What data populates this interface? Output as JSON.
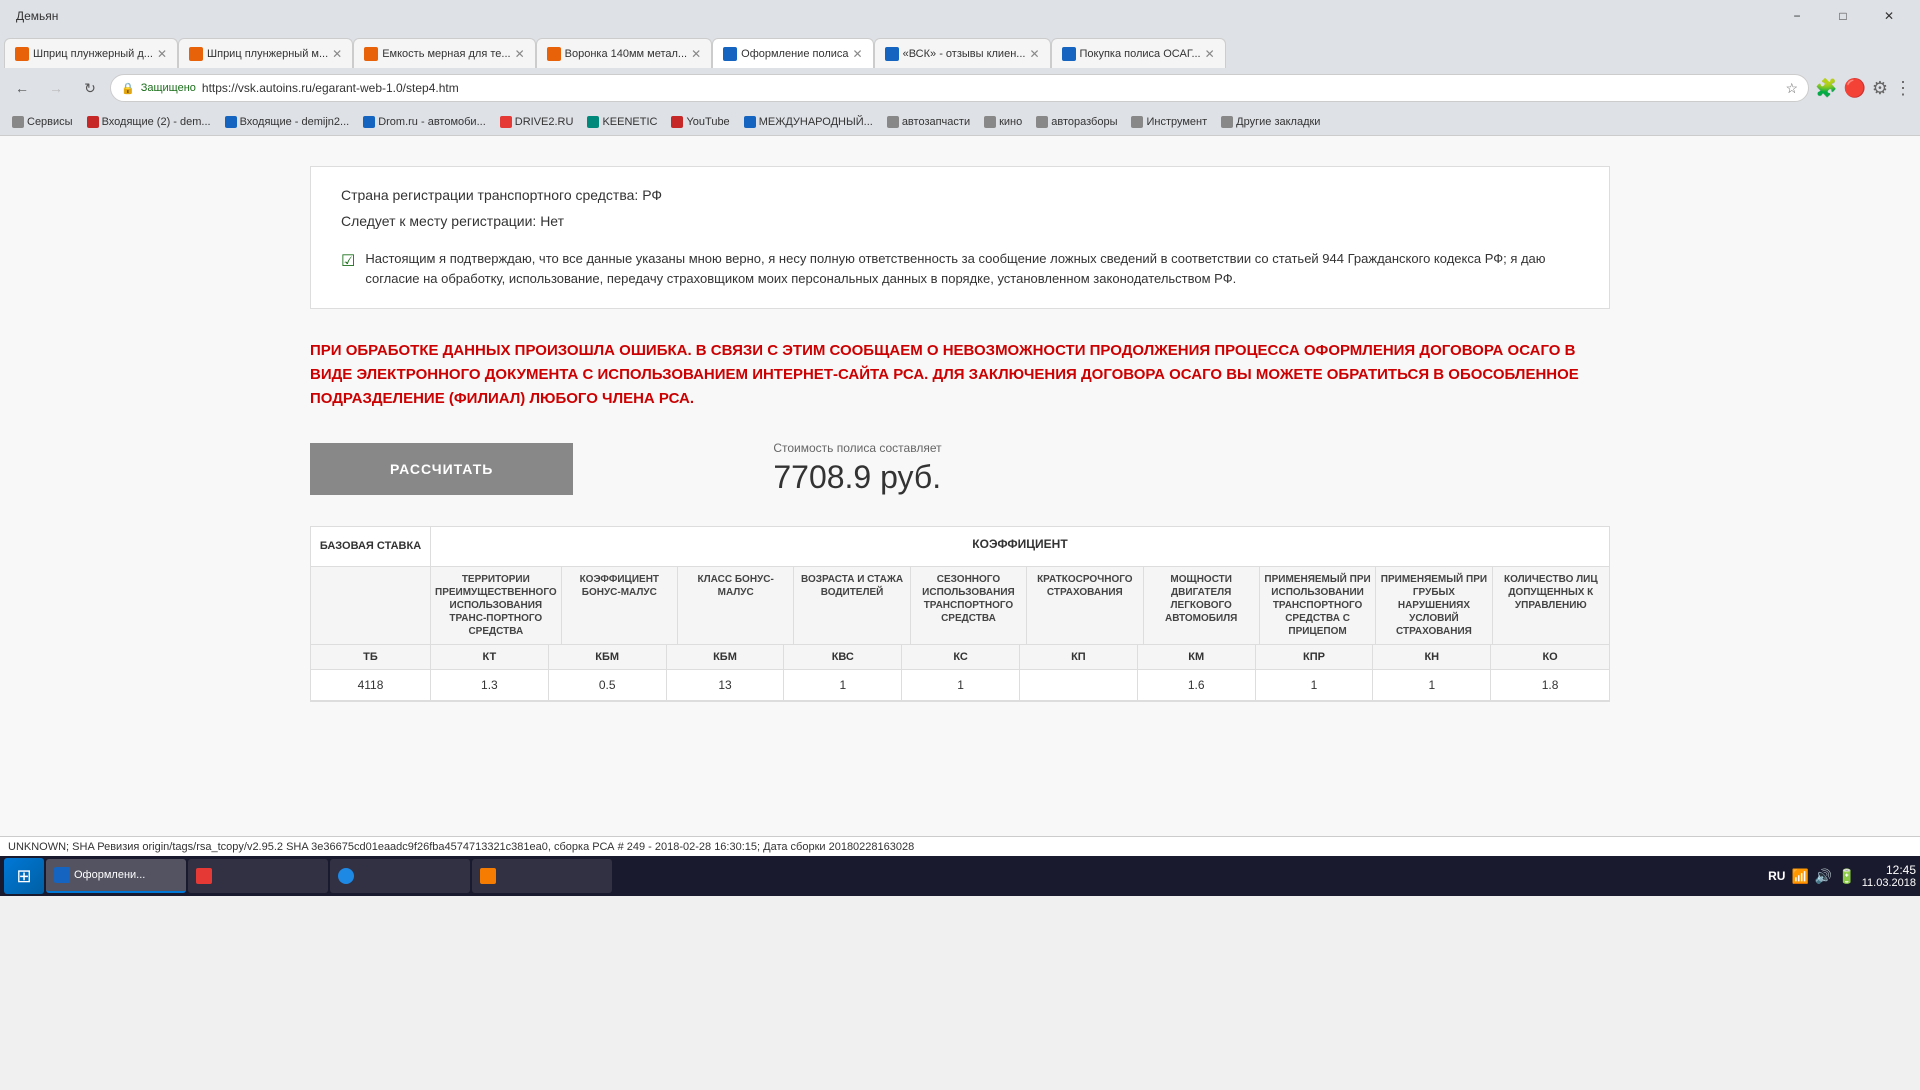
{
  "browser": {
    "title_user": "Демьян",
    "address": {
      "secure_label": "Защищено",
      "url": "https://vsk.autoins.ru/egarant-web-1.0/step4.htm"
    },
    "tabs": [
      {
        "id": "tab1",
        "title": "Шприц плунжерный д...",
        "active": false,
        "favicon_color": "#e8620a"
      },
      {
        "id": "tab2",
        "title": "Шприц плунжерный м...",
        "active": false,
        "favicon_color": "#e8620a"
      },
      {
        "id": "tab3",
        "title": "Емкость мерная для те...",
        "active": false,
        "favicon_color": "#e8620a"
      },
      {
        "id": "tab4",
        "title": "Воронка 140мм метал...",
        "active": false,
        "favicon_color": "#e8620a"
      },
      {
        "id": "tab5",
        "title": "Оформление полиса",
        "active": true,
        "favicon_color": "#1565c0"
      },
      {
        "id": "tab6",
        "title": "«ВСК» - отзывы клиен...",
        "active": false,
        "favicon_color": "#1565c0"
      },
      {
        "id": "tab7",
        "title": "Покупка полиса ОСАГ...",
        "active": false,
        "favicon_color": "#1565c0"
      }
    ],
    "bookmarks": [
      {
        "label": "Сервисы",
        "favicon_color": "#888"
      },
      {
        "label": "Входящие (2) - dem...",
        "favicon_color": "#c62828"
      },
      {
        "label": "Входящие - demijn2...",
        "favicon_color": "#1565c0"
      },
      {
        "label": "Drom.ru - автомоби...",
        "favicon_color": "#1565c0"
      },
      {
        "label": "DRIVE2.RU",
        "favicon_color": "#e53935"
      },
      {
        "label": "KEENETIC",
        "favicon_color": "#00897b"
      },
      {
        "label": "YouTube",
        "favicon_color": "#c62828"
      },
      {
        "label": "МЕЖДУНАРОДНЫЙ...",
        "favicon_color": "#1565c0"
      },
      {
        "label": "автозапчасти",
        "favicon_color": "#888"
      },
      {
        "label": "кино",
        "favicon_color": "#888"
      },
      {
        "label": "авторазборы",
        "favicon_color": "#888"
      },
      {
        "label": "Инструмент",
        "favicon_color": "#888"
      },
      {
        "label": "Другие закладки",
        "favicon_color": "#888"
      }
    ]
  },
  "page": {
    "info_rows": [
      {
        "label": "Страна регистрации транспортного средства: РФ"
      },
      {
        "label": "Следует к месту регистрации: Нет"
      }
    ],
    "checkbox_text": "Настоящим я подтверждаю, что все данные указаны мною верно, я несу полную ответственность за сообщение ложных сведений в соответствии со статьей 944 Гражданского кодекса РФ; я даю согласие на обработку, использование, передачу страховщиком моих персональных данных в порядке, установленном законодательством РФ.",
    "error_text": "ПРИ ОБРАБОТКЕ ДАННЫХ ПРОИЗОШЛА ОШИБКА. В СВЯЗИ С ЭТИМ СООБЩАЕМ О НЕВОЗМОЖНОСТИ ПРОДОЛЖЕНИЯ ПРОЦЕССА ОФОРМЛЕНИЯ ДОГОВОРА ОСАГО В ВИДЕ ЭЛЕКТРОННОГО ДОКУМЕНТА С ИСПОЛЬЗОВАНИЕМ ИНТЕРНЕТ-САЙТА РСА. ДЛЯ ЗАКЛЮЧЕНИЯ ДОГОВОРА ОСАГО ВЫ МОЖЕТЕ ОБРАТИТЬСЯ В ОБОСОБЛЕННОЕ ПОДРАЗДЕЛЕНИЕ (ФИЛИАЛ) ЛЮБОГО ЧЛЕНА РСА.",
    "calc_button_label": "РАССЧИТАТЬ",
    "price_label": "Стоимость полиса составляет",
    "price_value": "7708.9 руб.",
    "table": {
      "base_stavka_label": "БАЗОВАЯ СТАВКА",
      "coefficient_label": "КОЭФФИЦИЕНТ",
      "columns": [
        {
          "full": "ТЕРРИТОРИИ ПРЕИМУЩЕСТВЕННОГО ИСПОЛЬЗОВАНИЯ ТРАНСПОРТНОГО СРЕДСТВА",
          "abbrev": "КТ"
        },
        {
          "full": "КОЭФФИЦИЕНТ БОНУС-МАЛУС",
          "abbrev": "КБМ"
        },
        {
          "full": "КЛАСС БОНУС-МАЛУС",
          "abbrev": "КБМ"
        },
        {
          "full": "ВОЗРАСТА И СТАЖА ВОДИТЕЛЕЙ",
          "abbrev": "КВС"
        },
        {
          "full": "СЕЗОННОГО ИСПОЛЬЗОВАНИЯ ТРАНСПОРТНОГО СРЕДСТВА",
          "abbrev": "КС"
        },
        {
          "full": "КРАТКОСРОЧНОГО СТРАХОВАНИЯ",
          "abbrev": "КП"
        },
        {
          "full": "МОЩНОСТИ ДВИГАТЕЛЯ ЛЕГКОВОГО АВТОМОБИЛЯ",
          "abbrev": "КМ"
        },
        {
          "full": "ПРИМЕНЯЕМЫЙ ПРИ ИСПОЛЬЗОВАНИИ ТРАНСПОРТНОГО СРЕДСТВА С ПРИЦЕПОМ",
          "abbrev": "КПР"
        },
        {
          "full": "ПРИМЕНЯЕМЫЙ ПРИ ГРУБЫХ НАРУШЕНИЯХ УСЛОВИЙ СТРАХОВАНИЯ",
          "abbrev": "КН"
        },
        {
          "full": "КОЛИЧЕСТВО ЛИЦ ДОПУЩЕННЫХ К УПРАВЛЕНИЮ",
          "abbrev": "КО"
        }
      ],
      "base_abbrev": "ТБ",
      "data_row": {
        "tb": "4118",
        "kt": "1.3",
        "kbm_val": "0.5",
        "kbm_class": "13",
        "kvs": "1",
        "ks": "1",
        "kp": "",
        "km": "1.6",
        "kpr": "1",
        "kn": "1",
        "ko": "1.8"
      }
    }
  },
  "status_bar": {
    "text": "UNKNOWN; SHA Ревизия origin/tags/rsa_tcopy/v2.95.2 SHA 3e36675cd01eaadc9f26fba4574713321c381ea0, сборка РСА # 249 - 2018-02-28 16:30:15; Дата сборки 20180228163028"
  },
  "taskbar": {
    "start_icon": "⊞",
    "buttons": [
      {
        "label": "Оформлени...",
        "active": true,
        "icon_color": "#1565c0"
      },
      {
        "label": "",
        "active": false,
        "icon_color": "#e53935"
      },
      {
        "label": "",
        "active": false,
        "icon_color": "#388e3c"
      },
      {
        "label": "",
        "active": false,
        "icon_color": "#f57c00"
      }
    ],
    "tray": {
      "lang": "RU",
      "time": "12:45",
      "date": "11.03.2018"
    }
  }
}
